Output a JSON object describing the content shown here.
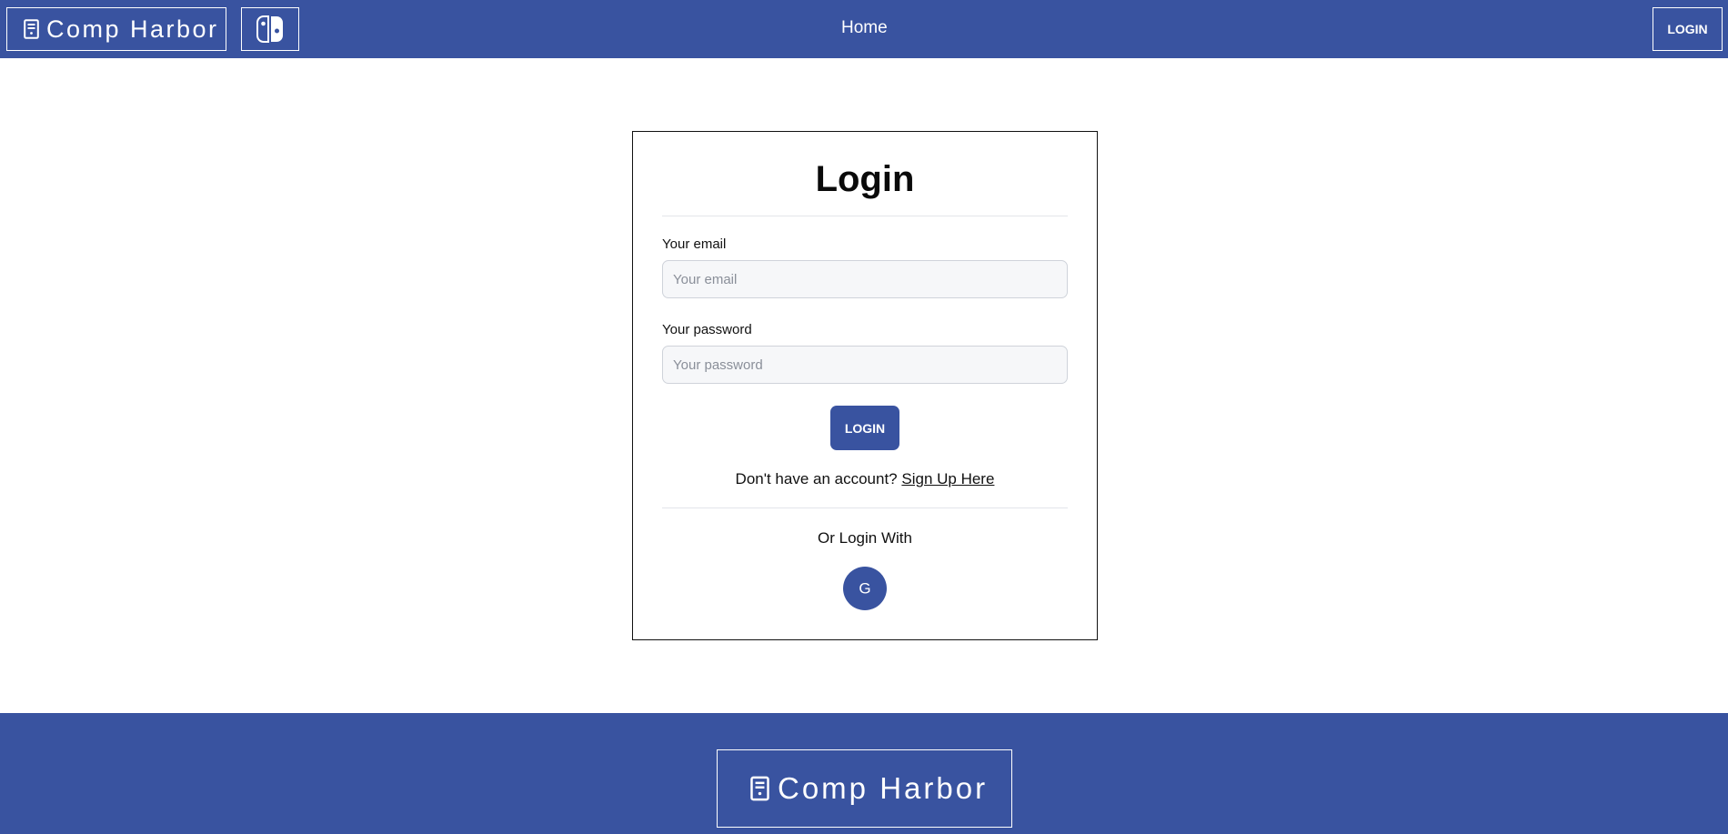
{
  "header": {
    "brand": "Comp Harbor",
    "home_link": "Home",
    "login_button": "LOGIN"
  },
  "login_card": {
    "title": "Login",
    "email_label": "Your email",
    "email_placeholder": "Your email",
    "email_value": "",
    "password_label": "Your password",
    "password_placeholder": "Your password",
    "password_value": "",
    "submit_label": "LOGIN",
    "signup_prompt": "Don't have an account?",
    "signup_link": "Sign Up Here",
    "alt_login_text": "Or Login With",
    "google_letter": "G"
  },
  "footer": {
    "brand": "Comp Harbor"
  },
  "icons": {
    "brand": "computer-tower-icon",
    "switch": "nintendo-switch-icon",
    "google": "google-icon"
  },
  "colors": {
    "primary": "#3953a0",
    "background": "#ffffff",
    "text": "#111111"
  }
}
